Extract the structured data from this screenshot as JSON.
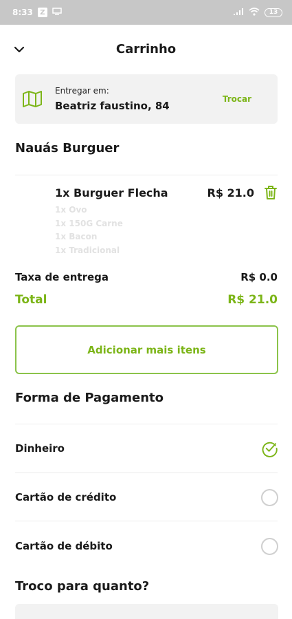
{
  "status_bar": {
    "time": "8:33",
    "box_glyph": "Z",
    "battery": "13"
  },
  "header": {
    "title": "Carrinho",
    "back_icon": "chevron-down-icon"
  },
  "address": {
    "icon": "map-icon",
    "label": "Entregar em:",
    "value": "Beatriz faustino, 84",
    "change_label": "Trocar"
  },
  "store": {
    "name": "Nauás Burguer"
  },
  "cart": {
    "items": [
      {
        "name": "1x Burguer Flecha",
        "price": "R$ 21.0",
        "addons": [
          "1x Ovo",
          "1x 150G Carne",
          "1x Bacon",
          "1x Tradicional"
        ]
      }
    ]
  },
  "summary": {
    "fee_label": "Taxa de entrega",
    "fee_value": "R$ 0.0",
    "total_label": "Total",
    "total_value": "R$ 21.0"
  },
  "add_more_label": "Adicionar mais itens",
  "payment": {
    "title": "Forma de Pagamento",
    "options": [
      {
        "label": "Dinheiro",
        "selected": true
      },
      {
        "label": "Cartão de crédito",
        "selected": false
      },
      {
        "label": "Cartão de débito",
        "selected": false
      }
    ]
  },
  "change": {
    "title": "Troco para quanto?"
  },
  "colors": {
    "accent": "#7cb518",
    "card_bg": "#f2f2f2",
    "status_bar": "#c7c7c7"
  }
}
